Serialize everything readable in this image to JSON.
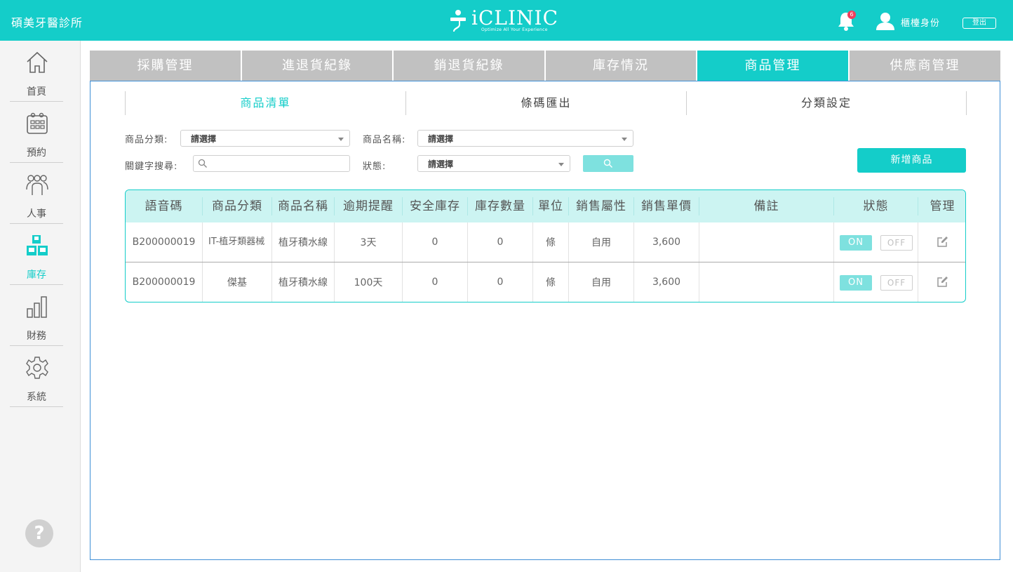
{
  "header": {
    "clinic_name": "碩美牙醫診所",
    "logo_text": "iCLINIC",
    "logo_slogan": "Optimize All Your Experience",
    "notification_count": "6",
    "user_role": "櫃檯身份",
    "logout_label": "登出"
  },
  "sidebar": {
    "items": [
      {
        "label": "首頁",
        "icon": "home-icon"
      },
      {
        "label": "預約",
        "icon": "calendar-icon"
      },
      {
        "label": "人事",
        "icon": "people-icon"
      },
      {
        "label": "庫存",
        "icon": "inventory-icon",
        "active": true
      },
      {
        "label": "財務",
        "icon": "bar-chart-icon"
      },
      {
        "label": "系統",
        "icon": "gear-icon"
      }
    ],
    "help_label": "?"
  },
  "main_tabs": [
    {
      "label": "採購管理"
    },
    {
      "label": "進退貨紀錄"
    },
    {
      "label": "銷退貨紀錄"
    },
    {
      "label": "庫存情況"
    },
    {
      "label": "商品管理",
      "active": true
    },
    {
      "label": "供應商管理"
    }
  ],
  "sub_tabs": [
    {
      "label": "商品清單",
      "active": true
    },
    {
      "label": "條碼匯出"
    },
    {
      "label": "分類設定"
    }
  ],
  "filters": {
    "category_label": "商品分類:",
    "category_value": "請選擇",
    "name_label": "商品名稱:",
    "name_value": "請選擇",
    "keyword_label": "關鍵字搜尋:",
    "keyword_value": "",
    "status_label": "狀態:",
    "status_value": "請選擇"
  },
  "add_button_label": "新增商品",
  "table": {
    "headers": [
      "語音碼",
      "商品分類",
      "商品名稱",
      "逾期提醒",
      "安全庫存",
      "庫存數量",
      "單位",
      "銷售屬性",
      "銷售單價",
      "備註",
      "狀態",
      "管理"
    ],
    "rows": [
      {
        "code": "B200000019",
        "category": "IT-植牙類器械",
        "name": "植牙積水線",
        "expiry": "3天",
        "safe_stock": "0",
        "stock": "0",
        "unit": "條",
        "sale_type": "自用",
        "price": "3,600",
        "note": "",
        "on_label": "ON",
        "off_label": "OFF"
      },
      {
        "code": "B200000019",
        "category": "傑基",
        "name": "植牙積水線",
        "expiry": "100天",
        "safe_stock": "0",
        "stock": "0",
        "unit": "條",
        "sale_type": "自用",
        "price": "3,600",
        "note": "",
        "on_label": "ON",
        "off_label": "OFF"
      }
    ]
  },
  "colors": {
    "accent": "#14cdc9",
    "tab_inactive": "#c1c1c1",
    "table_header": "#ccf4f2",
    "on_button": "#7ee1df",
    "panel_border": "#3f8fd6"
  }
}
